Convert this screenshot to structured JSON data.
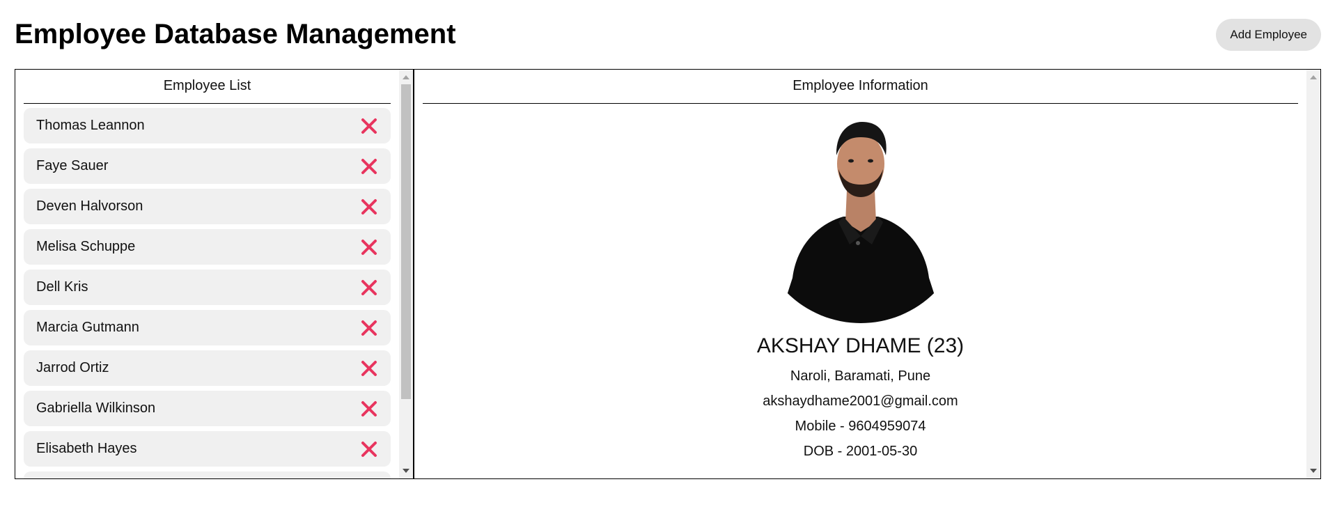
{
  "header": {
    "title": "Employee Database Management",
    "add_button_label": "Add Employee"
  },
  "list_panel": {
    "title": "Employee List",
    "employees": [
      {
        "name": "Thomas Leannon"
      },
      {
        "name": "Faye Sauer"
      },
      {
        "name": "Deven Halvorson"
      },
      {
        "name": "Melisa Schuppe"
      },
      {
        "name": "Dell Kris"
      },
      {
        "name": "Marcia Gutmann"
      },
      {
        "name": "Jarrod Ortiz"
      },
      {
        "name": "Gabriella Wilkinson"
      },
      {
        "name": "Elisabeth Hayes"
      }
    ],
    "delete_icon": "close-icon",
    "delete_icon_color": "#e8345e"
  },
  "info_panel": {
    "title": "Employee Information",
    "employee": {
      "name_age": "AKSHAY DHAME (23)",
      "address": "Naroli, Baramati, Pune",
      "email": "akshaydhame2001@gmail.com",
      "mobile": "Mobile - 9604959074",
      "dob": "DOB - 2001-05-30"
    }
  },
  "colors": {
    "accent_delete": "#e8345e",
    "item_background": "#f0f0f0",
    "button_background": "#e2e2e2"
  }
}
